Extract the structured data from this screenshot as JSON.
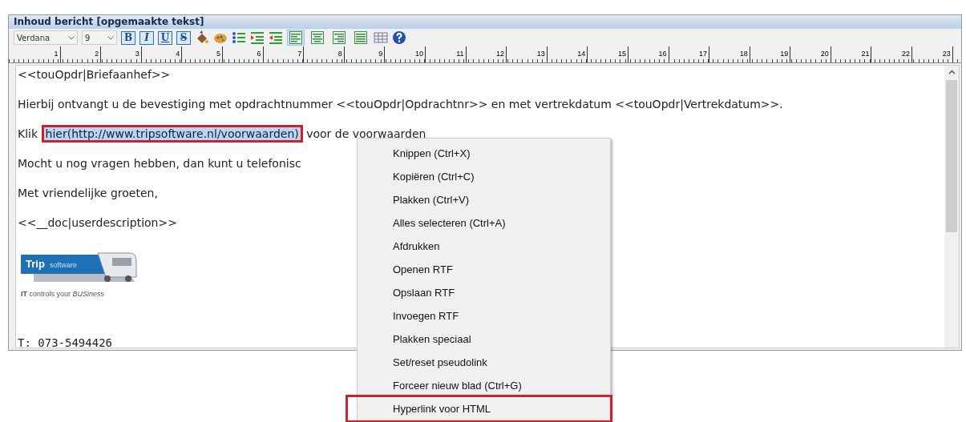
{
  "panel": {
    "title": "Inhoud bericht [opgemaakte tekst]"
  },
  "toolbar": {
    "font": "Verdana",
    "size": "9",
    "format_buttons": [
      {
        "label": "B",
        "kind": "bold"
      },
      {
        "label": "I",
        "kind": "italic"
      },
      {
        "label": "U",
        "kind": "underline"
      },
      {
        "label": "S",
        "kind": "strike"
      }
    ],
    "align_buttons": [
      {
        "kind": "left",
        "selected": true
      },
      {
        "kind": "center",
        "selected": false
      },
      {
        "kind": "right",
        "selected": false
      },
      {
        "kind": "justify",
        "selected": false
      }
    ]
  },
  "ruler": [
    "1",
    "2",
    "3",
    "4",
    "5",
    "6",
    "7",
    "8",
    "9",
    "10",
    "11",
    "12",
    "13",
    "14",
    "15",
    "16",
    "17",
    "18",
    "19",
    "20",
    "21",
    "22",
    "23"
  ],
  "document": [
    {
      "kind": "text",
      "text": "<<touOpdr|Briefaanhef>>"
    },
    {
      "kind": "text",
      "text": "Hierbij ontvangt u de bevestiging met opdrachtnummer <<touOpdr|Opdrachtnr>> en met vertrekdatum <<touOpdr|Vertrekdatum>>."
    },
    {
      "kind": "link",
      "before": "Klik",
      "link": "hier(http://www.tripsoftware.nl/voorwaarden)",
      "after": "voor de voorwaarden",
      "selected": true,
      "annotated": true
    },
    {
      "kind": "text",
      "text": "Mocht u nog vragen hebben, dan kunt u telefonisc"
    },
    {
      "kind": "text",
      "text": "Met vriendelijke groeten,"
    },
    {
      "kind": "text",
      "text": "<<__doc|userdescription>>"
    },
    {
      "kind": "logo",
      "brand": "Trip",
      "brand_suffix": "software",
      "tagline": "**IT** controls your *BUSiness*"
    },
    {
      "kind": "mono",
      "text": "T: 073-5494426"
    }
  ],
  "context_menu": [
    {
      "label": "Knippen (Ctrl+X)",
      "annotated": false
    },
    {
      "label": "Kopiëren (Ctrl+C)",
      "annotated": false
    },
    {
      "label": "Plakken (Ctrl+V)",
      "annotated": false
    },
    {
      "label": "Alles selecteren (Ctrl+A)",
      "annotated": false
    },
    {
      "label": "Afdrukken",
      "annotated": false
    },
    {
      "label": "Openen RTF",
      "annotated": false
    },
    {
      "label": "Opslaan RTF",
      "annotated": false
    },
    {
      "label": "Invoegen RTF",
      "annotated": false
    },
    {
      "label": "Plakken speciaal",
      "annotated": false
    },
    {
      "label": "Set/reset pseudolink",
      "annotated": false
    },
    {
      "label": "Forceer nieuw blad (Ctrl+G)",
      "annotated": false
    },
    {
      "label": "Hyperlink voor HTML",
      "annotated": true
    }
  ]
}
